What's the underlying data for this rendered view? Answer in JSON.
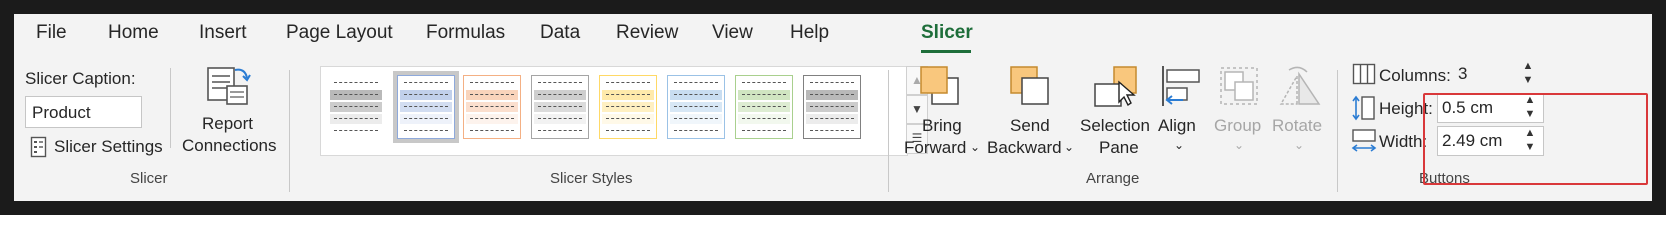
{
  "tabs": [
    {
      "label": "File"
    },
    {
      "label": "Home"
    },
    {
      "label": "Insert"
    },
    {
      "label": "Page Layout"
    },
    {
      "label": "Formulas"
    },
    {
      "label": "Data"
    },
    {
      "label": "Review"
    },
    {
      "label": "View"
    },
    {
      "label": "Help"
    },
    {
      "label": "Slicer",
      "active": true
    }
  ],
  "slicer_group": {
    "caption_label": "Slicer Caption:",
    "caption_value": "Product",
    "settings_label": "Slicer Settings",
    "report_connections_line1": "Report",
    "report_connections_line2": "Connections",
    "group_label": "Slicer"
  },
  "slicer_styles": {
    "group_label": "Slicer Styles",
    "tile_colors": [
      "#7f7f7f",
      "#8ea9db",
      "#f4b084",
      "#a5a5a5",
      "#ffd966",
      "#9bc2e6",
      "#a9d08e",
      "#808080"
    ],
    "selected_index": 1
  },
  "arrange": {
    "bring_forward_line1": "Bring",
    "bring_forward_line2": "Forward",
    "send_backward_line1": "Send",
    "send_backward_line2": "Backward",
    "selection_pane_line1": "Selection",
    "selection_pane_line2": "Pane",
    "align": "Align",
    "group": "Group",
    "rotate": "Rotate",
    "group_label": "Arrange"
  },
  "buttons": {
    "columns_label": "Columns:",
    "columns_value": "3",
    "height_label": "Height:",
    "height_value": "0.5 cm",
    "width_label": "Width:",
    "width_value": "2.49 cm",
    "group_label": "Buttons"
  },
  "colors": {
    "accent_green": "#1e6e3a",
    "highlight_red": "#d9383a",
    "arrange_orange": "#f9c77d"
  }
}
